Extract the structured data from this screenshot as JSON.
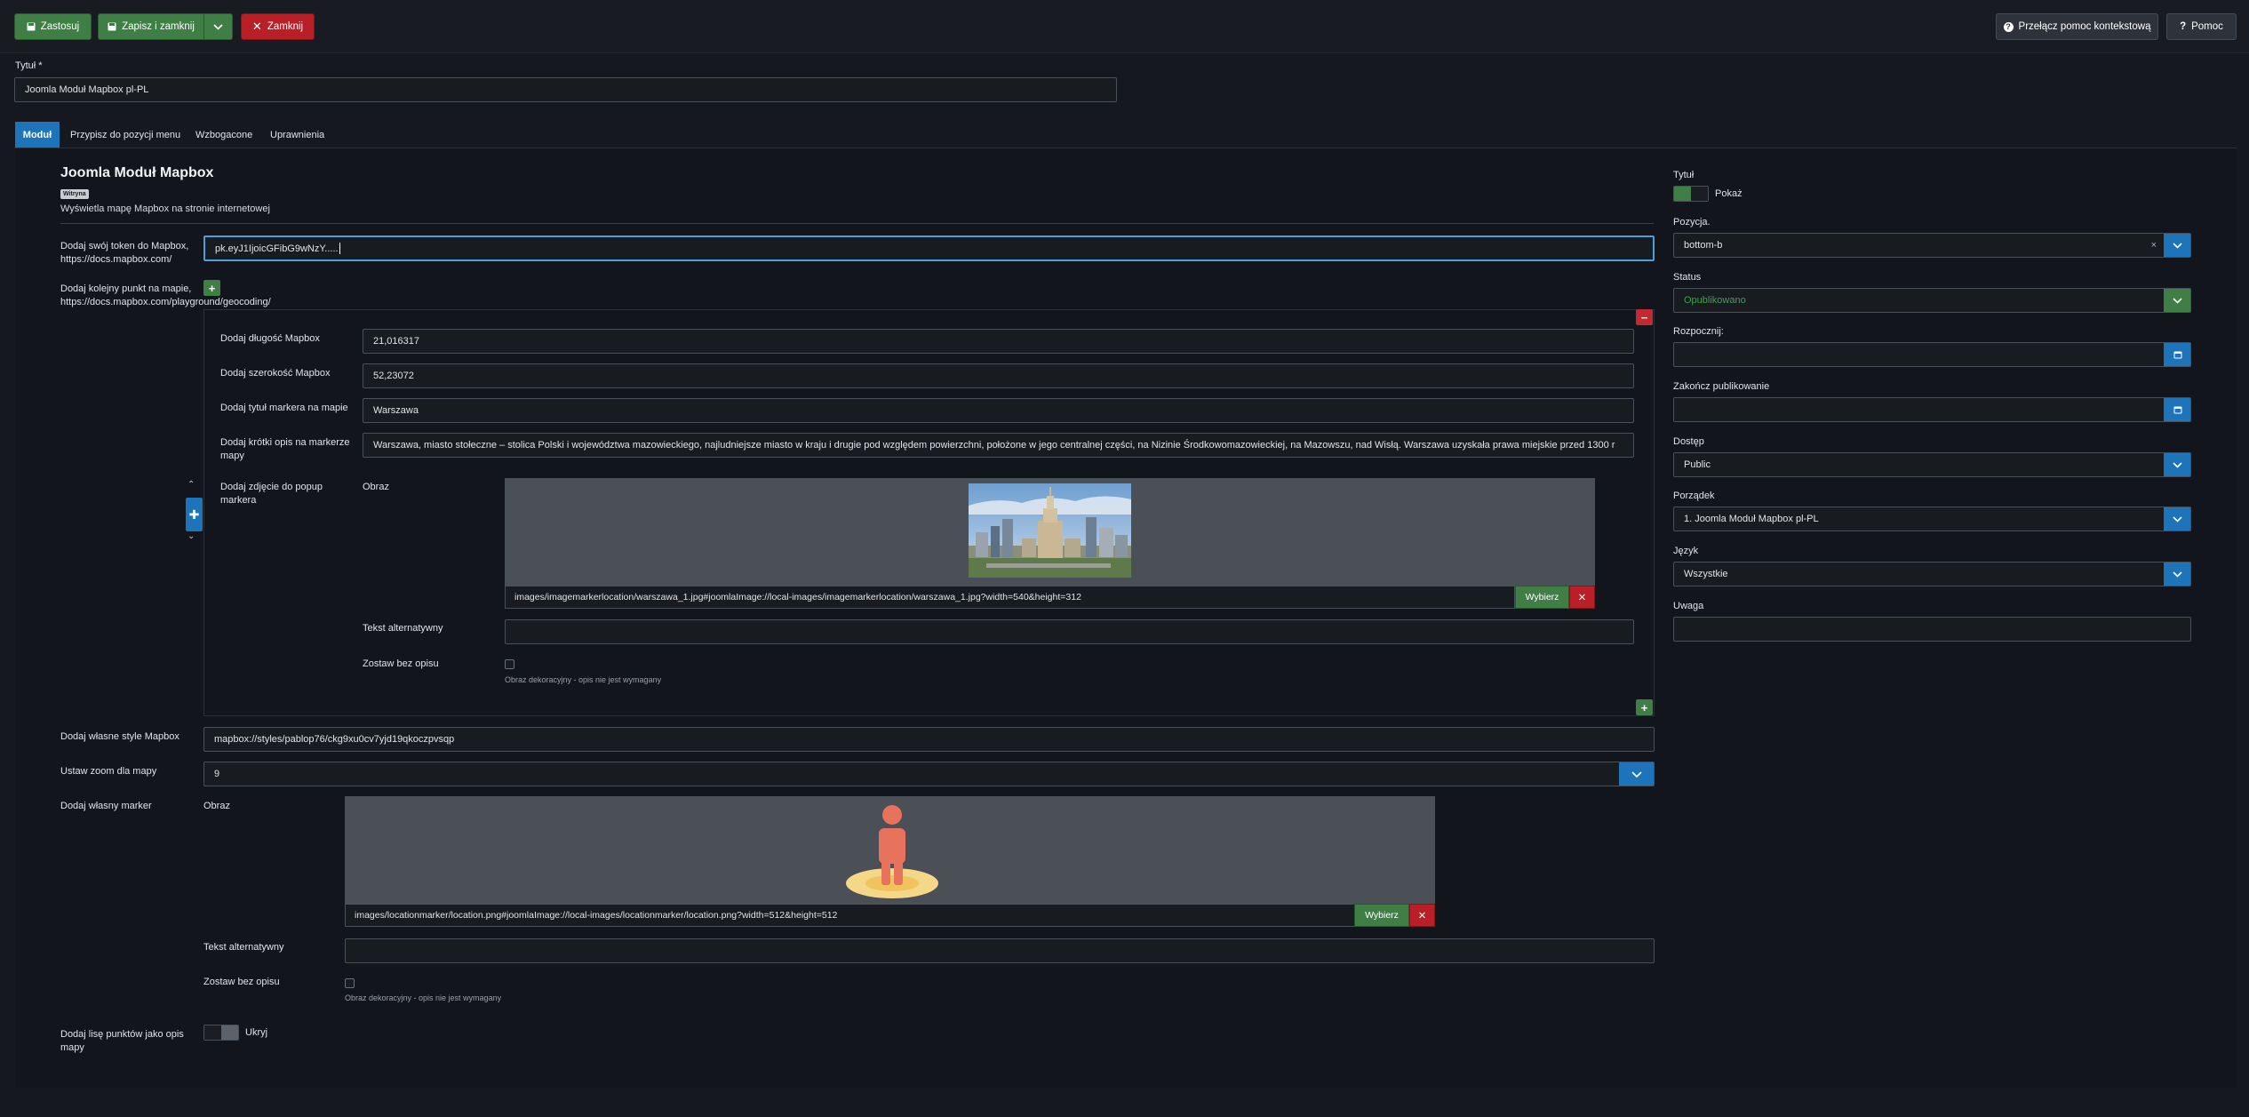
{
  "toolbar": {
    "apply": "Zastosuj",
    "save_close": "Zapisz i zamknij",
    "close": "Zamknij",
    "context_help": "Przełącz pomoc kontekstową",
    "help": "Pomoc"
  },
  "title_field": {
    "label": "Tytuł *",
    "value": "Joomla Moduł Mapbox pl-PL"
  },
  "tabs": [
    "Moduł",
    "Przypisz do pozycji menu",
    "Wzbogacone",
    "Uprawnienia"
  ],
  "module": {
    "heading": "Joomla Moduł Mapbox",
    "badge": "Witryna",
    "description": "Wyświetla mapę Mapbox na stronie internetowej"
  },
  "token": {
    "label": "Dodaj swój token do Mapbox, https://docs.mapbox.com/",
    "value": "pk.eyJ1IjoicGFibG9wNzY....."
  },
  "point": {
    "label": "Dodaj kolejny punkt na mapie, https://docs.mapbox.com/playground/geocoding/",
    "lng_label": "Dodaj długość Mapbox",
    "lng_value": "21,016317",
    "lat_label": "Dodaj szerokość Mapbox",
    "lat_value": "52,23072",
    "title_label": "Dodaj tytuł markera na mapie",
    "title_value": "Warszawa",
    "desc_label": "Dodaj krótki opis na markerze mapy",
    "desc_value": "Warszawa, miasto stołeczne – stolica Polski i województwa mazowieckiego, najludniejsze miasto w kraju i drugie pod względem powierzchni, położone w jego centralnej części, na Nizinie Środkowomazowieckiej, na Mazowszu, nad Wisłą. Warszawa uzyskała prawa miejskie przed 1300 r",
    "photo_label": "Dodaj zdjęcie do popup markera",
    "image_label": "Obraz",
    "image_path": "images/imagemarkerlocation/warszawa_1.jpg#joomlaImage://local-images/imagemarkerlocation/warszawa_1.jpg?width=540&height=312",
    "select": "Wybierz",
    "alt_label": "Tekst alternatywny",
    "alt_value": "",
    "nodesc_label": "Zostaw bez opisu",
    "nodesc_hint": "Obraz dekoracyjny - opis nie jest wymagany"
  },
  "style": {
    "label": "Dodaj własne style Mapbox",
    "value": "mapbox://styles/pablop76/ckg9xu0cv7yjd19qkoczpvsqp"
  },
  "zoom": {
    "label": "Ustaw zoom dla mapy",
    "value": "9"
  },
  "marker": {
    "label": "Dodaj własny marker",
    "image_label": "Obraz",
    "image_path": "images/locationmarker/location.png#joomlaImage://local-images/locationmarker/location.png?width=512&height=512",
    "select": "Wybierz",
    "alt_label": "Tekst alternatywny",
    "alt_value": "",
    "nodesc_label": "Zostaw bez opisu",
    "nodesc_hint": "Obraz dekoracyjny - opis nie jest wymagany"
  },
  "list_points": {
    "label": "Dodaj lisę punktów jako opis mapy",
    "state": "Ukryj"
  },
  "sidebar": {
    "title_label": "Tytuł",
    "title_state": "Pokaż",
    "position_label": "Pozycja.",
    "position_value": "bottom-b",
    "status_label": "Status",
    "status_value": "Opublikowano",
    "start_label": "Rozpocznij:",
    "start_value": "",
    "end_label": "Zakończ publikowanie",
    "end_value": "",
    "access_label": "Dostęp",
    "access_value": "Public",
    "order_label": "Porządek",
    "order_value": "1. Joomla Moduł Mapbox pl-PL",
    "lang_label": "Język",
    "lang_value": "Wszystkie",
    "note_label": "Uwaga",
    "note_value": ""
  },
  "colors": {
    "green": "#3f7f45",
    "red": "#b81f26",
    "blue": "#1d74b8",
    "published": "#3fa34d"
  }
}
